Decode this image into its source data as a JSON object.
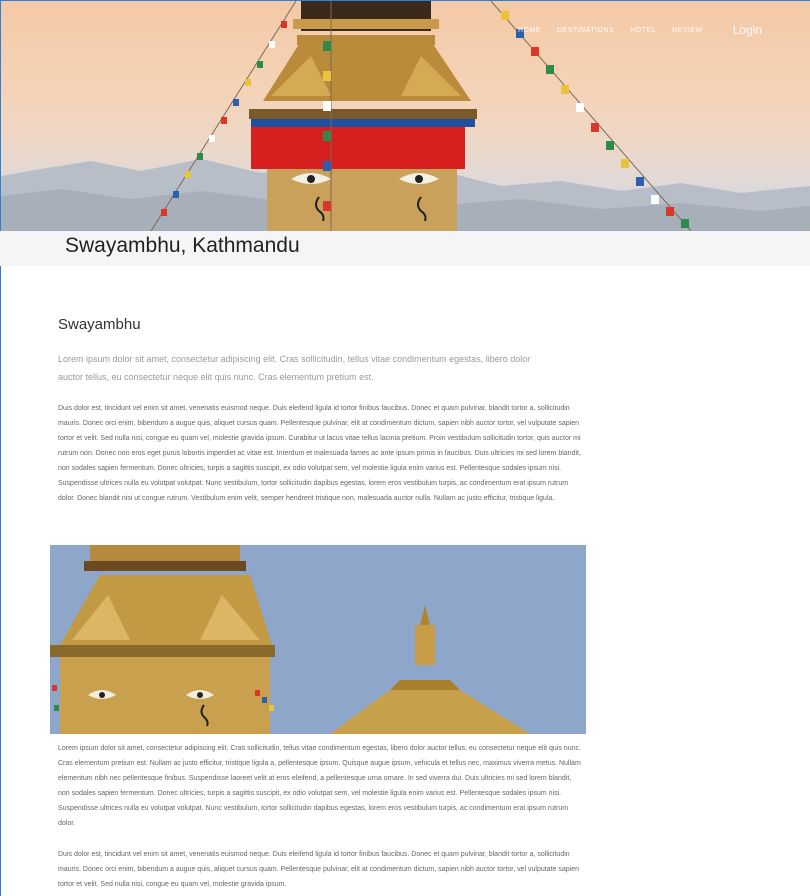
{
  "nav": {
    "items": [
      "Home",
      "Destinations",
      "Hotel",
      "Review"
    ],
    "login": "Login"
  },
  "page": {
    "title": "Swayambhu, Kathmandu"
  },
  "article": {
    "heading": "Swayambhu",
    "lede": "Lorem ipsum dolor sit amet, consectetur adipiscing elit. Cras sollicitudin, tellus vitae condimentum egestas, libero dolor auctor tellus, eu consectetur neque elit quis nunc. Cras elementum pretium est.",
    "paragraph1": "Duis dolor est, tincidunt vel enim sit amet, venenatis euismod neque. Duis eleifend ligula id tortor finibus faucibus. Donec et quam pulvinar, blandit tortor a, sollicitudin mauris. Donec orci enim, bibendum a augue quis, aliquet cursus quam. Pellentesque pulvinar, elit at condimentum dictum, sapien nibh auctor tortor, vel vulputate sapien tortor et velit. Sed nulla nisi, congue eu quam vel, molestie gravida ipsum. Curabitur ut lacus vitae tellus lacinia pretium. Proin vestibulum sollicitudin tortor, quis auctor mi rutrum non. Donec non eros eget purus lobortis imperdiet ac vitae est. Interdum et malesuada fames ac ante ipsum primis in faucibus. Duis ultricies mi sed lorem blandit, non sodales sapien fermentum. Donec ultricies, turpis a sagittis suscipit, ex odio volutpat sem, vel molestie ligula enim varius est. Pellentesque sodales ipsum nisi. Suspendisse ultrices nulla eu volutpat volutpat. Nunc vestibulum, tortor sollicitudin dapibus egestas, lorem eros vestibulum turpis, ac condimentum erat ipsum rutrum dolor. Donec blandit nisi ut congue rutrum. Vestibulum enim velit, semper hendrerit tristique non, malesuada auctor nulla. Nullam ac justo efficitur, tristique ligula.",
    "paragraph2": "Lorem ipsum dolor sit amet, consectetur adipiscing elit. Cras sollicitudin, tellus vitae condimentum egestas, libero dolor auctor tellus, eu consectetur neque elit quis nunc. Cras elementum pretium est. Nullam ac justo efficitur, tristique ligula a, pellentesque ipsum. Quisque augue ipsum, vehicula et tellus nec, maximus viverra metus. Nullam elementum nibh nec pellentesque finibus. Suspendisse laoreet velit at eros eleifend, a pellentesque urna ornare. In sed viverra dui. Duis ultricies mi sed lorem blandit, non sodales sapien fermentum. Donec ultricies, turpis a sagittis suscipit, ex odio volutpat sem, vel molestie ligula enim varius est. Pellentesque sodales ipsum nisi. Suspendisse ultrices nulla eu volutpat volutpat. Nunc vestibulum, tortor sollicitudin dapibus egestas, lorem eros vestibulum turpis, ac condimentum erat ipsum rutrum dolor.",
    "paragraph3": "Duis dolor est, tincidunt vel enim sit amet, venenatis euismod neque. Duis eleifend ligula id tortor finibus faucibus. Donec et quam pulvinar, blandit tortor a, sollicitudin mauris. Donec orci enim, bibendum a augue quis, aliquet cursus quam. Pellentesque pulvinar, elit at condimentum dictum, sapien nibh auctor tortor, vel vulputate sapien tortor et velit. Sed nulla nisi, congue eu quam vel, molestie gravida ipsum."
  }
}
